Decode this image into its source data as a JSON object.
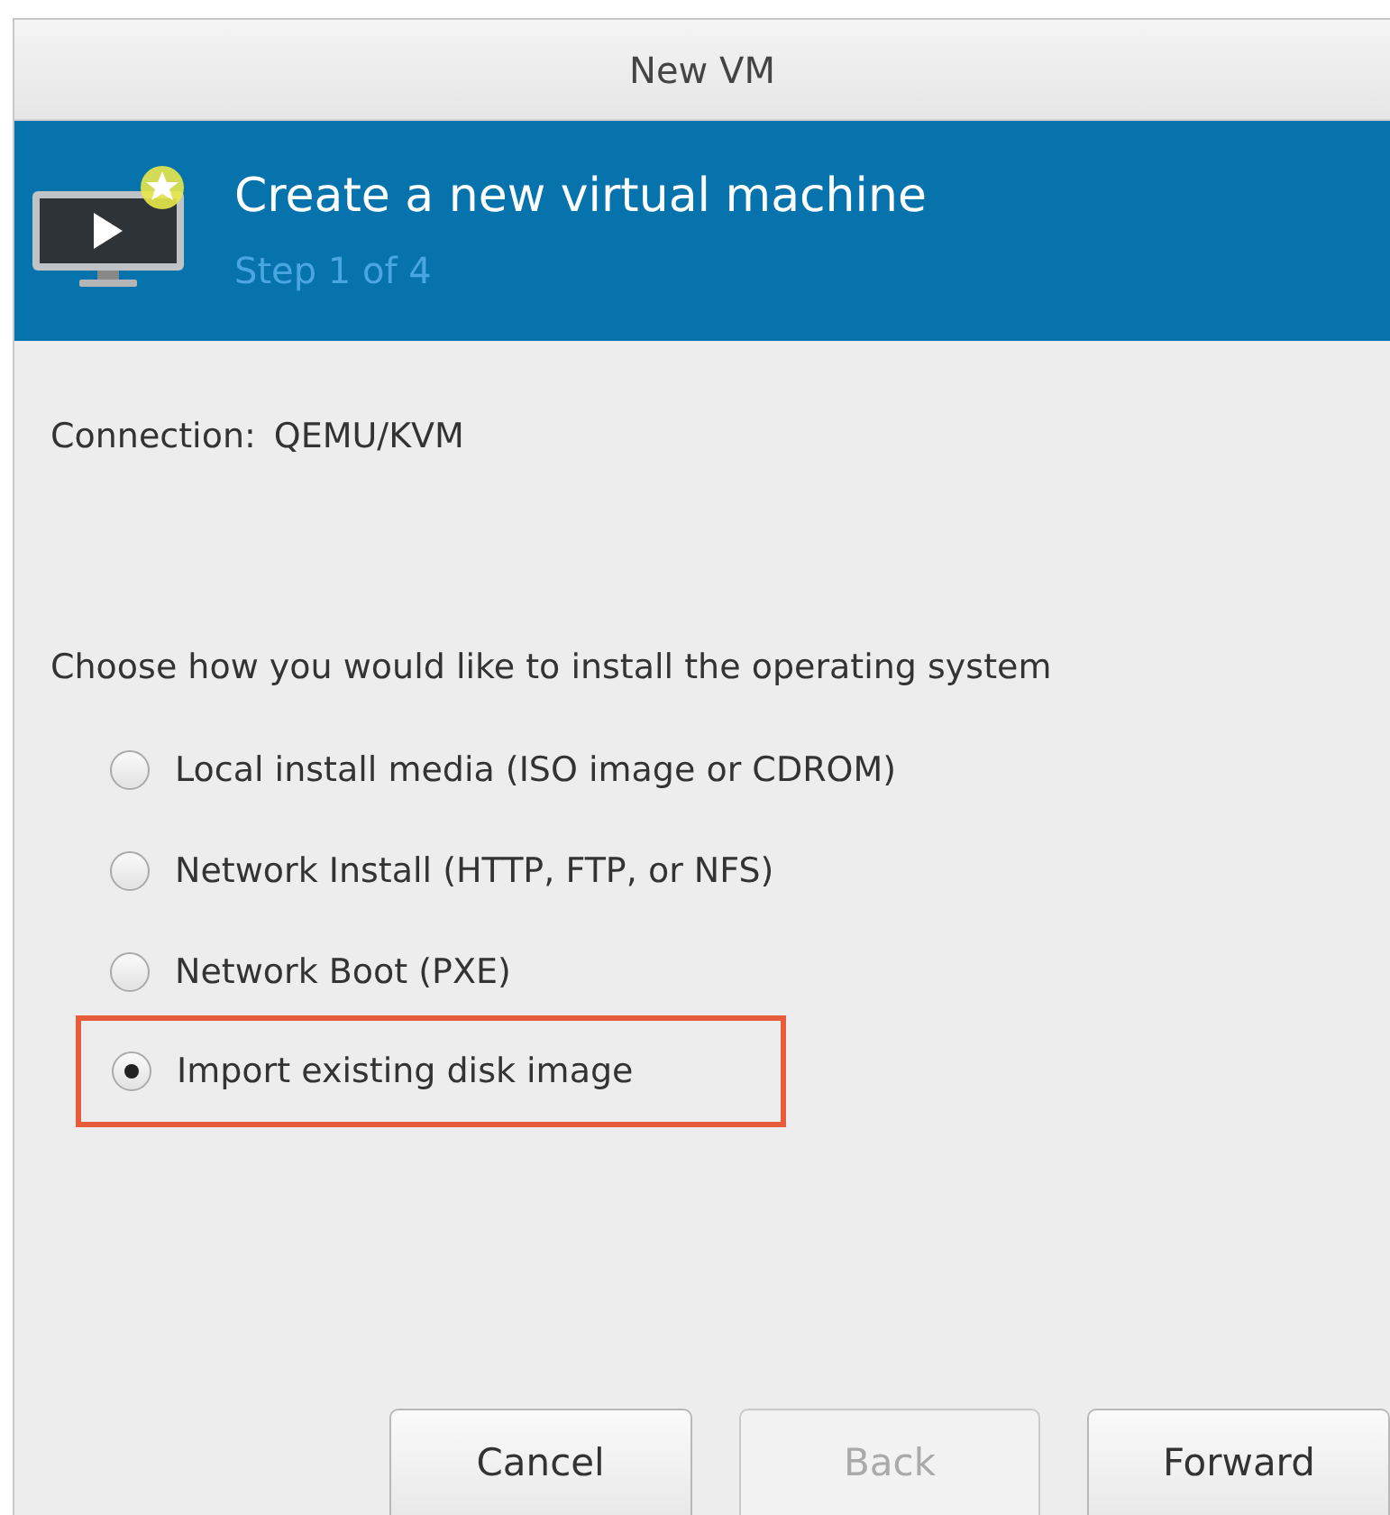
{
  "window": {
    "title": "New VM"
  },
  "banner": {
    "title": "Create a new virtual machine",
    "step": "Step 1 of 4"
  },
  "connection": {
    "label": "Connection:",
    "value": "QEMU/KVM"
  },
  "prompt": "Choose how you would like to install the operating system",
  "options": [
    {
      "label": "Local install media (ISO image or CDROM)",
      "selected": false,
      "highlighted": false
    },
    {
      "label": "Network Install (HTTP, FTP, or NFS)",
      "selected": false,
      "highlighted": false
    },
    {
      "label": "Network Boot (PXE)",
      "selected": false,
      "highlighted": false
    },
    {
      "label": "Import existing disk image",
      "selected": true,
      "highlighted": true
    }
  ],
  "buttons": [
    {
      "label": "Cancel",
      "disabled": false
    },
    {
      "label": "Back",
      "disabled": true
    },
    {
      "label": "Forward",
      "disabled": false
    }
  ]
}
